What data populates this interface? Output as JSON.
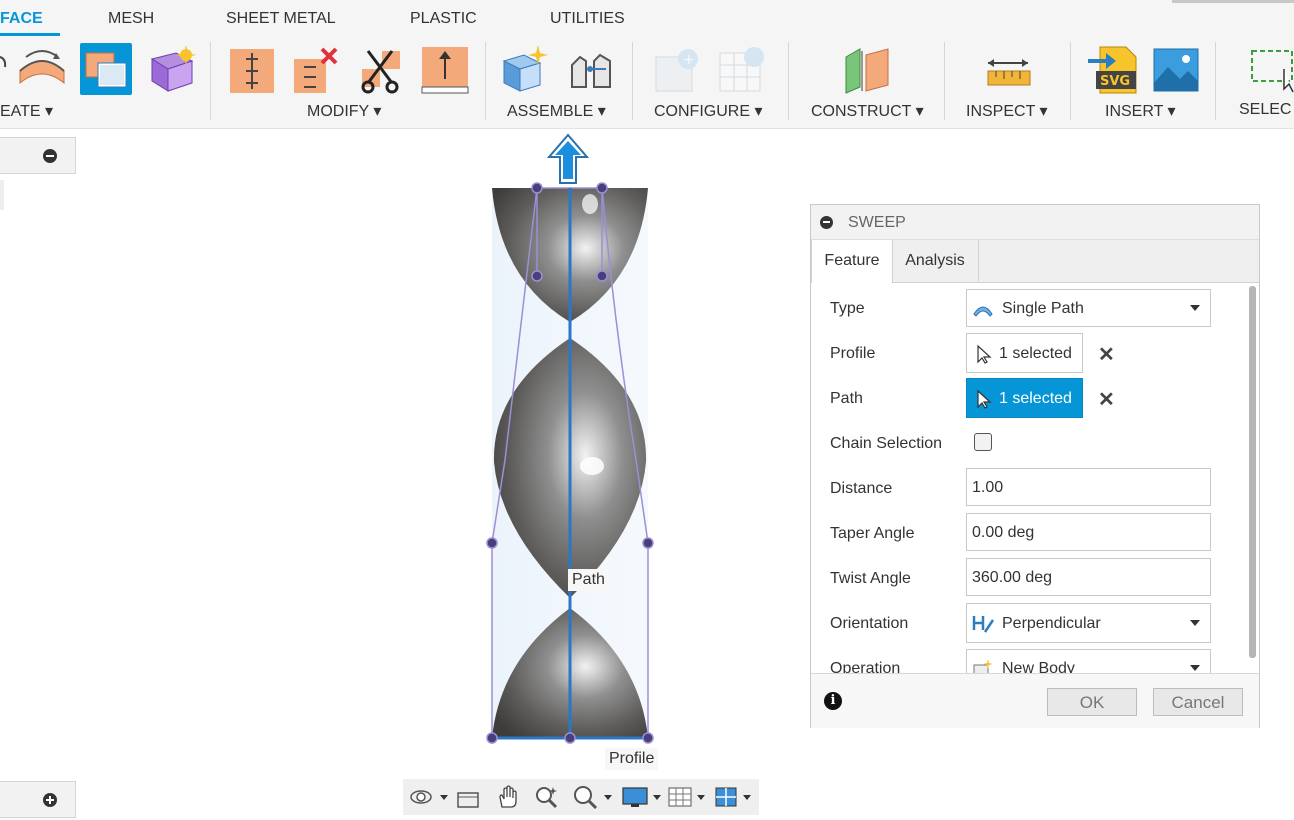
{
  "tabs": [
    "FACE",
    "MESH",
    "SHEET METAL",
    "PLASTIC",
    "UTILITIES"
  ],
  "active_tab": "FACE",
  "ribbon": {
    "groups": {
      "create": "EATE ▾",
      "modify": "MODIFY ▾",
      "assemble": "ASSEMBLE ▾",
      "configure": "CONFIGURE ▾",
      "construct": "CONSTRUCT ▾",
      "inspect": "INSPECT ▾",
      "insert": "INSERT ▾",
      "select": "SELEC"
    },
    "icons": [
      "sweep-icon",
      "extrude-box-icon",
      "pattern-cube-icon",
      "press-pull-icon",
      "delete-face-icon",
      "scissors-icon",
      "offset-face-icon",
      "new-component-icon",
      "joint-icon",
      "configure-table-icon",
      "configure-grid-icon",
      "offset-plane-icon",
      "measure-icon",
      "insert-svg-icon",
      "insert-canvas-icon",
      "select-window-icon"
    ],
    "svg_badge": "SVG"
  },
  "viewport": {
    "path_label": "Path",
    "profile_label": "Profile"
  },
  "sweep": {
    "title": "SWEEP",
    "tabs": [
      "Feature",
      "Analysis"
    ],
    "fields": {
      "type_label": "Type",
      "type_value": "Single Path",
      "profile_label": "Profile",
      "profile_value": "1 selected",
      "path_label": "Path",
      "path_value": "1 selected",
      "chain_label": "Chain Selection",
      "chain_checked": false,
      "distance_label": "Distance",
      "distance_value": "1.00",
      "taper_label": "Taper Angle",
      "taper_value": "0.00 deg",
      "twist_label": "Twist Angle",
      "twist_value": "360.00 deg",
      "orientation_label": "Orientation",
      "orientation_value": "Perpendicular",
      "operation_label": "Operation",
      "operation_value": "New Body"
    },
    "ok": "OK",
    "cancel": "Cancel"
  },
  "colors": {
    "accent": "#0696d7",
    "path_button": "#0696d7",
    "sketch_line": "#9b8fd6"
  }
}
